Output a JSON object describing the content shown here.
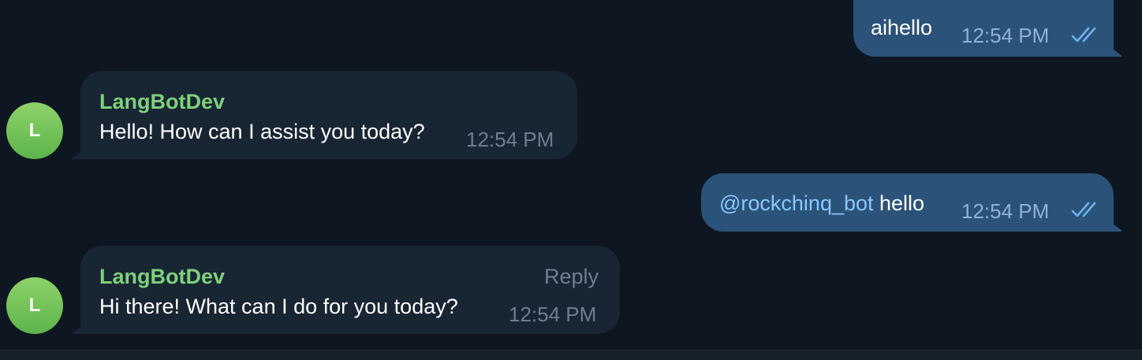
{
  "messages": [
    {
      "direction": "outgoing",
      "text": "aihello",
      "time": "12:54 PM",
      "status": "double-check-icon"
    },
    {
      "direction": "incoming",
      "sender": "LangBotDev",
      "avatar_letter": "L",
      "text": "Hello! How can I assist you today?",
      "time": "12:54 PM"
    },
    {
      "direction": "outgoing",
      "mention": "@rockchinq_bot",
      "text": " hello",
      "time": "12:54 PM",
      "status": "double-check-icon"
    },
    {
      "direction": "incoming",
      "sender": "LangBotDev",
      "avatar_letter": "L",
      "text": "Hi there! What can I do for you today?",
      "time": "12:54 PM",
      "reply_label": "Reply"
    }
  ],
  "colors": {
    "background": "#0e1621",
    "outgoing_bubble": "#2b5278",
    "incoming_bubble": "#182533",
    "sender_name": "#7ed17a",
    "mention": "#8ac7ff",
    "avatar": "#6cc35a"
  }
}
